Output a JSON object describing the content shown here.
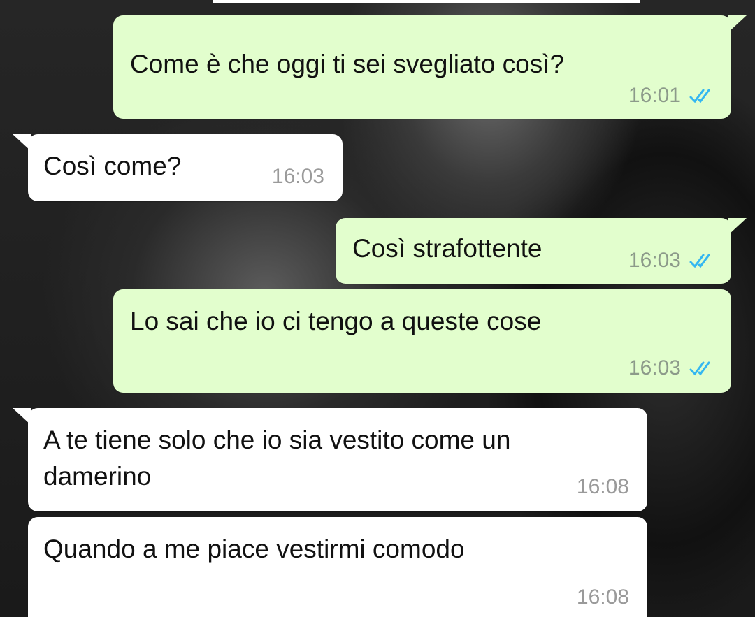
{
  "chat": {
    "messages": [
      {
        "direction": "out",
        "text": "Come è che oggi ti sei svegliato così?",
        "time": "16:01",
        "status": "read"
      },
      {
        "direction": "in",
        "text": "Così come?",
        "time": "16:03"
      },
      {
        "direction": "out",
        "text": "Così strafottente",
        "time": "16:03",
        "status": "read"
      },
      {
        "direction": "out",
        "text": "Lo sai che io ci tengo a queste cose",
        "time": "16:03",
        "status": "read"
      },
      {
        "direction": "in",
        "text_line1": "A te tiene solo che io sia vestito come un",
        "text_line2": "damerino",
        "time": "16:08"
      },
      {
        "direction": "in",
        "text": "Quando a me piace vestirmi comodo",
        "time": "16:08"
      }
    ]
  },
  "icons": {
    "read_receipt": "double-check-icon"
  },
  "colors": {
    "outgoing_bubble": "#e2fecd",
    "incoming_bubble": "#ffffff",
    "read_ticks": "#34b7f1",
    "timestamp": "#8c9a8a"
  }
}
